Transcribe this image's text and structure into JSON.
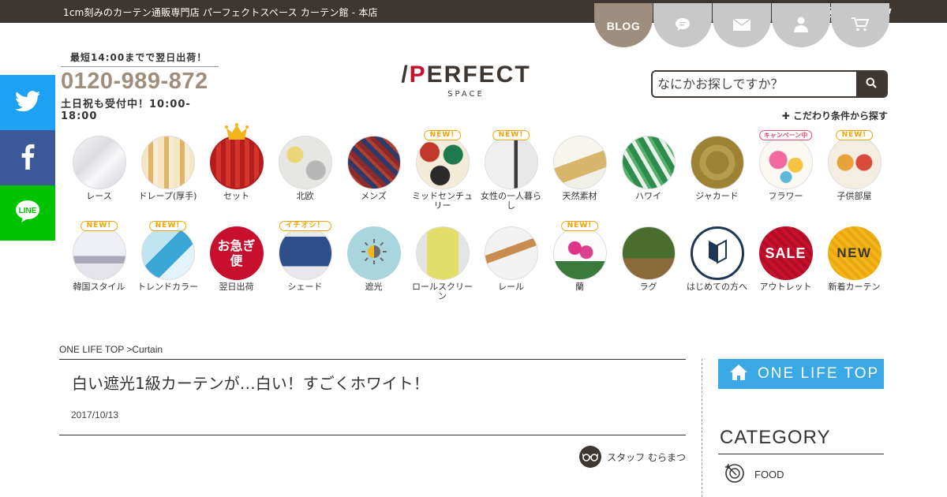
{
  "topbar": {
    "site_title": "1cm刻みのカーテン通販専門店 パーフェクトスペース カーテン館 - 本店"
  },
  "header_nav": {
    "blog_label": "BLOG"
  },
  "phone": {
    "note": "最短14:00までで翌日出荷！",
    "number": "0120-989-872",
    "hours": "土日祝も受付中！10:00-18:00"
  },
  "logo": {
    "main_prefix": "/",
    "main_p": "P",
    "main_rest": "ERFECT",
    "sub": "SPACE"
  },
  "search": {
    "placeholder": "なにかお探しですか？"
  },
  "advanced_search": "✚ こだわり条件から探す",
  "side_social": {
    "line_label": "LINE"
  },
  "categories_row1": [
    {
      "label": "レース",
      "tag": ""
    },
    {
      "label": "ドレープ(厚手)",
      "tag": ""
    },
    {
      "label": "セット",
      "tag": ""
    },
    {
      "label": "北欧",
      "tag": ""
    },
    {
      "label": "メンズ",
      "tag": ""
    },
    {
      "label": "ミッドセンチュリー",
      "tag": "NEW!"
    },
    {
      "label": "女性の一人暮らし",
      "tag": "NEW!"
    },
    {
      "label": "天然素材",
      "tag": ""
    },
    {
      "label": "ハワイ",
      "tag": ""
    },
    {
      "label": "ジャカード",
      "tag": ""
    },
    {
      "label": "フラワー",
      "tag": "キャンペーン中"
    },
    {
      "label": "子供部屋",
      "tag": "NEW!"
    }
  ],
  "categories_row2": [
    {
      "label": "韓国スタイル",
      "tag": "NEW!"
    },
    {
      "label": "トレンドカラー",
      "tag": "NEW!"
    },
    {
      "label": "翌日出荷",
      "tag": "",
      "circle_text": "お急ぎ便"
    },
    {
      "label": "シェード",
      "tag": "イチオシ！"
    },
    {
      "label": "遮光",
      "tag": ""
    },
    {
      "label": "ロールスクリーン",
      "tag": ""
    },
    {
      "label": "レール",
      "tag": ""
    },
    {
      "label": "蘭",
      "tag": "NEW!"
    },
    {
      "label": "ラグ",
      "tag": ""
    },
    {
      "label": "はじめての方へ",
      "tag": ""
    },
    {
      "label": "アウトレット",
      "tag": "",
      "circle_text": "SALE"
    },
    {
      "label": "新着カーテン",
      "tag": "",
      "circle_text": "NEW"
    }
  ],
  "breadcrumb": "ONE LIFE TOP >Curtain",
  "article": {
    "title": "白い遮光1級カーテンが…白い！すごくホワイト！",
    "date": "2017/10/13",
    "author": "スタッフ むらまつ"
  },
  "sidebar": {
    "one_life_top": "ONE LIFE TOP",
    "category_heading": "CATEGORY",
    "category_items": [
      "FOOD"
    ]
  },
  "colors": {
    "topbar": "#3d3631",
    "accent_brown": "#9e8e7e",
    "brand_red": "#c8102e",
    "sidebar_blue": "#3ba8e6",
    "twitter": "#1da1f2",
    "facebook": "#3b5998",
    "line": "#00c300"
  }
}
